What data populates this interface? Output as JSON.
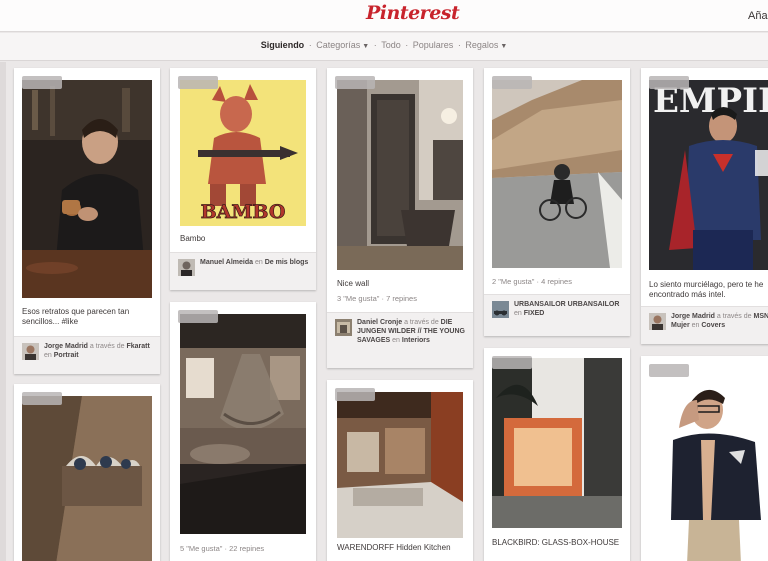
{
  "header": {
    "logo": "Pinterest",
    "add_link": "Añad"
  },
  "nav": {
    "active": "Siguiendo",
    "categorias": "Categorías",
    "todo": "Todo",
    "populares": "Populares",
    "regalos": "Regalos",
    "separator": "·"
  },
  "pins": {
    "coffee_man": {
      "description": "Esos retratos que parecen tan sencillos... #like",
      "user": "Jorge Madrid",
      "via_text": "a través de",
      "source": "Fkaratt",
      "on_text": "en",
      "board": "Portrait"
    },
    "bambo": {
      "poster_word": "BAMBO",
      "description": "Bambo",
      "user": "Manuel Almeida",
      "on_text": "en",
      "board": "De mis blogs"
    },
    "interior_tub": {
      "description": "Nice wall",
      "stats": "3 \"Me gusta\" · 7 repines",
      "user": "Daniel Cronje",
      "via_text": "a través de",
      "source": "DIE JUNGEN WILDER // THE YOUNG SAVAGES",
      "on_text": "en",
      "board": "Interiors"
    },
    "cyclist": {
      "stats": "2 \"Me gusta\" · 4 repines",
      "user": "URBANSAILOR URBANSAILOR",
      "on_text": "en",
      "board": "FIXED"
    },
    "empire": {
      "masthead": "EMPIRE",
      "description": "Lo siento murciélago, pero te he encontrado más intel.",
      "user": "Jorge Madrid",
      "via_text": "a través de",
      "source": "MSN Mujer",
      "on_text": "en",
      "board": "Covers"
    },
    "hammock": {
      "stats": "5 \"Me gusta\" · 22 repines"
    },
    "kitchen": {
      "description": "WARENDORFF Hidden Kitchen"
    },
    "blackbird": {
      "description": "BLACKBIRD: GLASS-BOX-HOUSE"
    }
  },
  "colors": {
    "brand": "#c8232c",
    "background": "#ebe8e8"
  }
}
